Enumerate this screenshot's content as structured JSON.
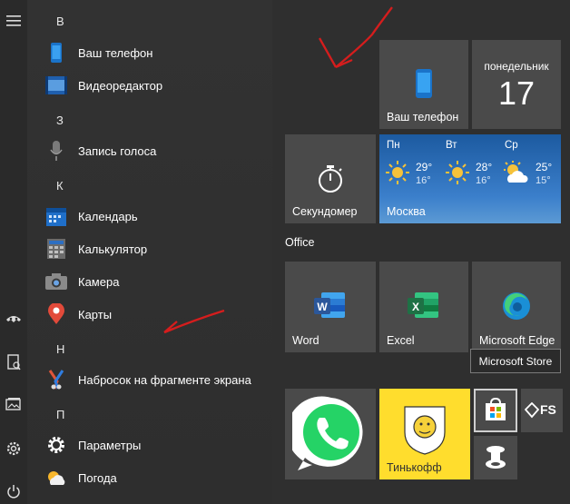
{
  "sidebar_icons": [
    "menu-icon",
    "user-avatar-icon",
    "documents-icon",
    "pictures-icon",
    "settings-icon",
    "power-icon"
  ],
  "app_list": {
    "groups": [
      {
        "letter": "В",
        "apps": [
          {
            "label": "Ваш телефон",
            "icon": "phone-icon"
          },
          {
            "label": "Видеоредактор",
            "icon": "video-editor-icon"
          }
        ]
      },
      {
        "letter": "З",
        "apps": [
          {
            "label": "Запись голоса",
            "icon": "microphone-icon"
          }
        ]
      },
      {
        "letter": "К",
        "apps": [
          {
            "label": "Календарь",
            "icon": "calendar-icon"
          },
          {
            "label": "Калькулятор",
            "icon": "calculator-icon"
          },
          {
            "label": "Камера",
            "icon": "camera-icon"
          },
          {
            "label": "Карты",
            "icon": "maps-pin-icon"
          }
        ]
      },
      {
        "letter": "Н",
        "apps": [
          {
            "label": "Набросок на фрагменте экрана",
            "icon": "snip-sketch-icon"
          }
        ]
      },
      {
        "letter": "П",
        "apps": [
          {
            "label": "Параметры",
            "icon": "gear-icon"
          },
          {
            "label": "Погода",
            "icon": "weather-icon"
          }
        ]
      }
    ]
  },
  "tiles": {
    "phone": {
      "label": "Ваш телефон"
    },
    "calendar": {
      "weekday": "понедельник",
      "day": "17"
    },
    "stopwatch": {
      "label": "Секундомер"
    },
    "weather": {
      "city": "Москва",
      "days": [
        {
          "day": "Пн",
          "hi": "29°",
          "lo": "16°",
          "icon": "sunny-icon"
        },
        {
          "day": "Вт",
          "hi": "28°",
          "lo": "16°",
          "icon": "sunny-icon"
        },
        {
          "day": "Ср",
          "hi": "25°",
          "lo": "15°",
          "icon": "partly-cloudy-icon"
        }
      ]
    },
    "section_title": "Office",
    "word": {
      "label": "Word"
    },
    "excel": {
      "label": "Excel"
    },
    "edge": {
      "label": "Microsoft Edge"
    },
    "whatsapp": {
      "label": ""
    },
    "tinkoff": {
      "label": "Тинькофф"
    },
    "store": {
      "tooltip": "Microsoft Store"
    },
    "fs": {
      "label": "FS"
    }
  },
  "colors": {
    "word": "#2b579a",
    "excel": "#1e7145",
    "whatsapp": "#25d366",
    "tinkoff": "#ffdd2d",
    "weather": "#2b6cb8",
    "annotation": "#d51d1d"
  }
}
